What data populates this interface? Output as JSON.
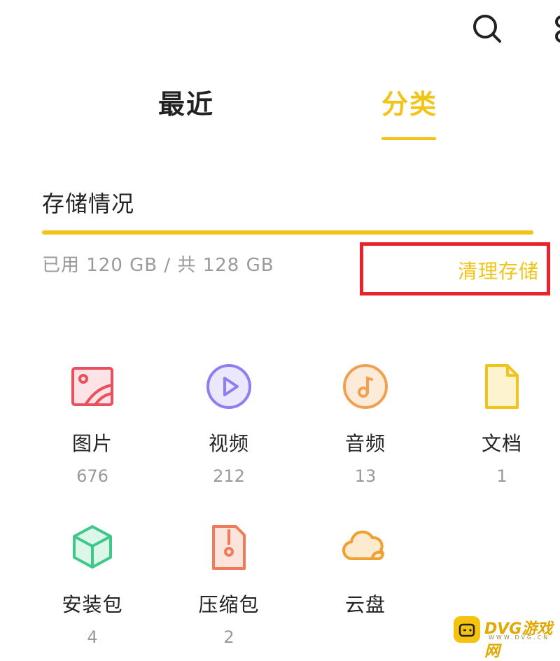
{
  "colors": {
    "accent": "#f0c419",
    "highlight_box": "#e8232c",
    "images": "#e8505b",
    "videos": "#8c7ff2",
    "audio": "#f0a050",
    "docs": "#f0c419",
    "apks": "#3ec98a",
    "archives": "#f07b5a",
    "cloud": "#f0a030"
  },
  "header": {
    "search_icon": "search-icon",
    "more_icon": "more-icon"
  },
  "tabs": [
    {
      "label": "最近",
      "active": false
    },
    {
      "label": "分类",
      "active": true
    }
  ],
  "storage": {
    "title": "存储情况",
    "usage_text": "已用 120 GB / 共 128 GB",
    "used_fraction": 1.0,
    "clean_label": "清理存储"
  },
  "categories": [
    {
      "label": "图片",
      "count": "676",
      "icon": "image-icon"
    },
    {
      "label": "视频",
      "count": "212",
      "icon": "video-play-icon"
    },
    {
      "label": "音频",
      "count": "13",
      "icon": "music-note-icon"
    },
    {
      "label": "文档",
      "count": "1",
      "icon": "document-icon"
    },
    {
      "label": "安装包",
      "count": "4",
      "icon": "package-cube-icon"
    },
    {
      "label": "压缩包",
      "count": "2",
      "icon": "archive-icon"
    },
    {
      "label": "云盘",
      "count": "",
      "icon": "cloud-icon"
    }
  ],
  "watermark": {
    "text": "DVG游戏网",
    "sub": "WWW.DVG.CN"
  }
}
